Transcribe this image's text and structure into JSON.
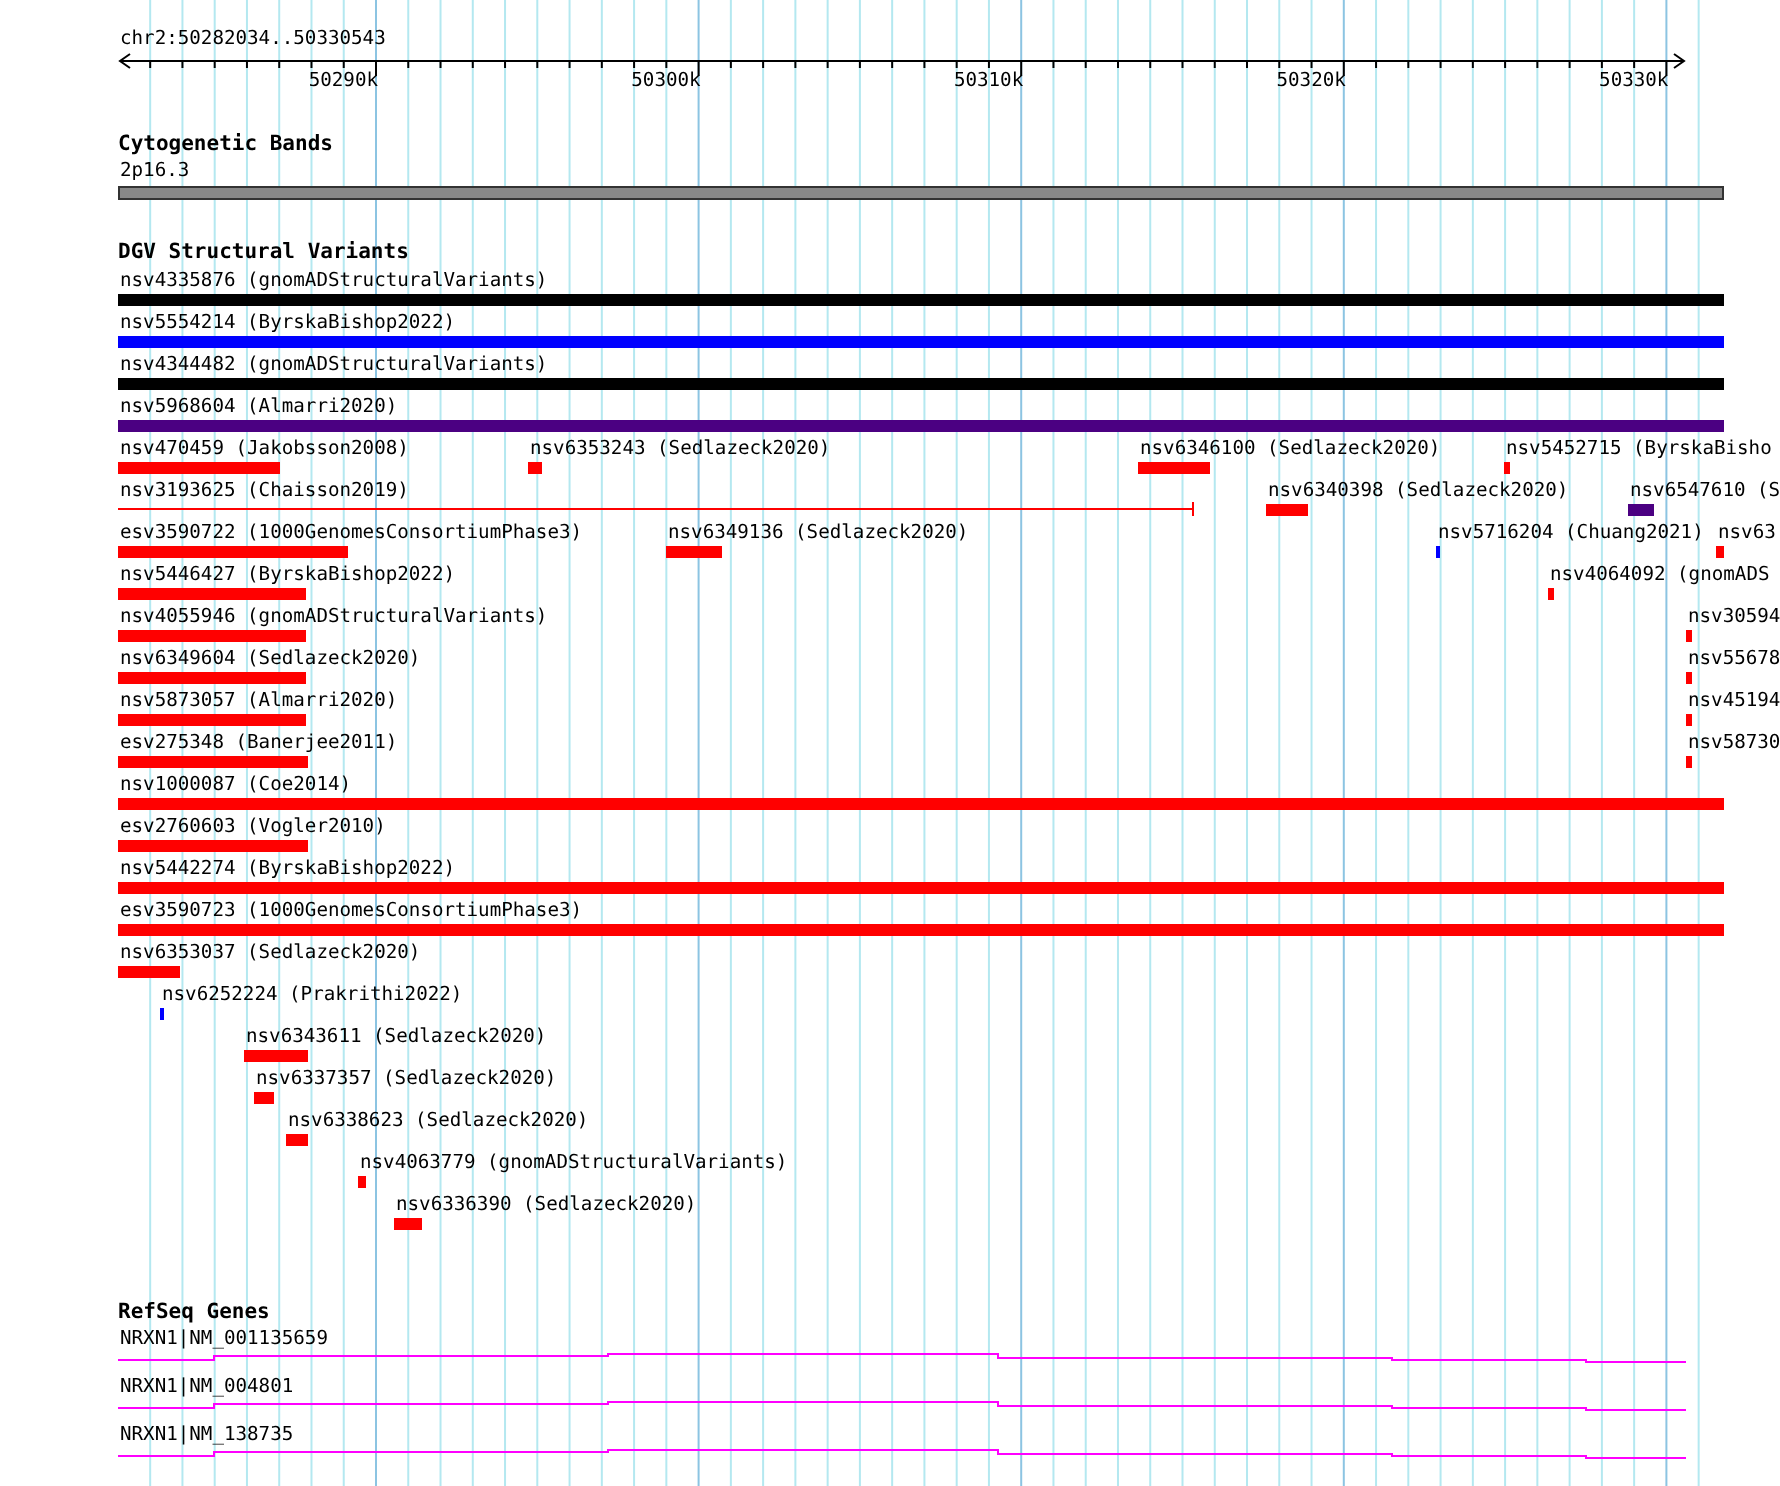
{
  "ruler": {
    "location": "chr2:50282034..50330543",
    "ticks": [
      "50290k",
      "50300k",
      "50310k",
      "50320k",
      "50330k"
    ]
  },
  "cytogenetic_bands": {
    "title": "Cytogenetic Bands",
    "band": "2p16.3"
  },
  "dgv_structural_variants": {
    "title": "DGV Structural Variants",
    "rows": [
      {
        "features": [
          {
            "label": "nsv4335876 (gnomADStructuralVariants)",
            "color": "#000000",
            "kind": "bar"
          }
        ]
      },
      {
        "features": [
          {
            "label": "nsv5554214 (ByrskaBishop2022)",
            "color": "#0000ff",
            "kind": "bar"
          }
        ]
      },
      {
        "features": [
          {
            "label": "nsv4344482 (gnomADStructuralVariants)",
            "color": "#000000",
            "kind": "bar"
          }
        ]
      },
      {
        "features": [
          {
            "label": "nsv5968604 (Almarri2020)",
            "color": "#4b0082",
            "kind": "bar"
          }
        ]
      },
      {
        "features": [
          {
            "label": "nsv470459 (Jakobsson2008)",
            "color": "#ff0000",
            "kind": "bar"
          },
          {
            "label": "nsv6353243 (Sedlazeck2020)",
            "color": "#ff0000",
            "kind": "bar"
          },
          {
            "label": "nsv6346100 (Sedlazeck2020)",
            "color": "#ff0000",
            "kind": "bar"
          },
          {
            "label": "nsv5452715 (ByrskaBisho",
            "color": "#ff0000",
            "kind": "bar"
          }
        ]
      },
      {
        "features": [
          {
            "label": "nsv3193625 (Chaisson2019)",
            "color": "#ff0000",
            "kind": "line"
          },
          {
            "label": "nsv6340398 (Sedlazeck2020)",
            "color": "#ff0000",
            "kind": "bar"
          },
          {
            "label": "nsv6547610 (S",
            "color": "#4b0082",
            "kind": "bar"
          }
        ]
      },
      {
        "features": [
          {
            "label": "esv3590722 (1000GenomesConsortiumPhase3)",
            "color": "#ff0000",
            "kind": "bar"
          },
          {
            "label": "nsv6349136 (Sedlazeck2020)",
            "color": "#ff0000",
            "kind": "bar"
          },
          {
            "label": "nsv5716204 (Chuang2021)",
            "color": "#0000ff",
            "kind": "bar"
          },
          {
            "label": "nsv63",
            "color": "#ff0000",
            "kind": "bar"
          }
        ]
      },
      {
        "features": [
          {
            "label": "nsv5446427 (ByrskaBishop2022)",
            "color": "#ff0000",
            "kind": "bar"
          },
          {
            "label": "nsv4064092 (gnomADS",
            "color": "#ff0000",
            "kind": "bar"
          }
        ]
      },
      {
        "features": [
          {
            "label": "nsv4055946 (gnomADStructuralVariants)",
            "color": "#ff0000",
            "kind": "bar"
          },
          {
            "label": "nsv30594",
            "color": "#ff0000",
            "kind": "bar"
          }
        ]
      },
      {
        "features": [
          {
            "label": "nsv6349604 (Sedlazeck2020)",
            "color": "#ff0000",
            "kind": "bar"
          },
          {
            "label": "nsv55678",
            "color": "#ff0000",
            "kind": "bar"
          }
        ]
      },
      {
        "features": [
          {
            "label": "nsv5873057 (Almarri2020)",
            "color": "#ff0000",
            "kind": "bar"
          },
          {
            "label": "nsv45194",
            "color": "#ff0000",
            "kind": "bar"
          }
        ]
      },
      {
        "features": [
          {
            "label": "esv275348 (Banerjee2011)",
            "color": "#ff0000",
            "kind": "bar"
          },
          {
            "label": "nsv58730",
            "color": "#ff0000",
            "kind": "bar"
          }
        ]
      },
      {
        "features": [
          {
            "label": "nsv1000087 (Coe2014)",
            "color": "#ff0000",
            "kind": "bar"
          }
        ]
      },
      {
        "features": [
          {
            "label": "esv2760603 (Vogler2010)",
            "color": "#ff0000",
            "kind": "bar"
          }
        ]
      },
      {
        "features": [
          {
            "label": "nsv5442274 (ByrskaBishop2022)",
            "color": "#ff0000",
            "kind": "bar"
          }
        ]
      },
      {
        "features": [
          {
            "label": "esv3590723 (1000GenomesConsortiumPhase3)",
            "color": "#ff0000",
            "kind": "bar"
          }
        ]
      },
      {
        "features": [
          {
            "label": "nsv6353037 (Sedlazeck2020)",
            "color": "#ff0000",
            "kind": "bar"
          }
        ]
      },
      {
        "features": [
          {
            "label": "nsv6252224 (Prakrithi2022)",
            "color": "#0000ff",
            "kind": "bar"
          }
        ]
      },
      {
        "features": [
          {
            "label": "nsv6343611 (Sedlazeck2020)",
            "color": "#ff0000",
            "kind": "bar"
          }
        ]
      },
      {
        "features": [
          {
            "label": "nsv6337357 (Sedlazeck2020)",
            "color": "#ff0000",
            "kind": "bar"
          }
        ]
      },
      {
        "features": [
          {
            "label": "nsv6338623 (Sedlazeck2020)",
            "color": "#ff0000",
            "kind": "bar"
          }
        ]
      },
      {
        "features": [
          {
            "label": "nsv4063779 (gnomADStructuralVariants)",
            "color": "#ff0000",
            "kind": "bar"
          }
        ]
      },
      {
        "features": [
          {
            "label": "nsv6336390 (Sedlazeck2020)",
            "color": "#ff0000",
            "kind": "bar"
          }
        ]
      }
    ]
  },
  "refseq_genes": {
    "title": "RefSeq Genes",
    "transcripts": [
      {
        "label": "NRXN1|NM_001135659"
      },
      {
        "label": "NRXN1|NM_004801"
      },
      {
        "label": "NRXN1|NM_138735"
      }
    ]
  }
}
